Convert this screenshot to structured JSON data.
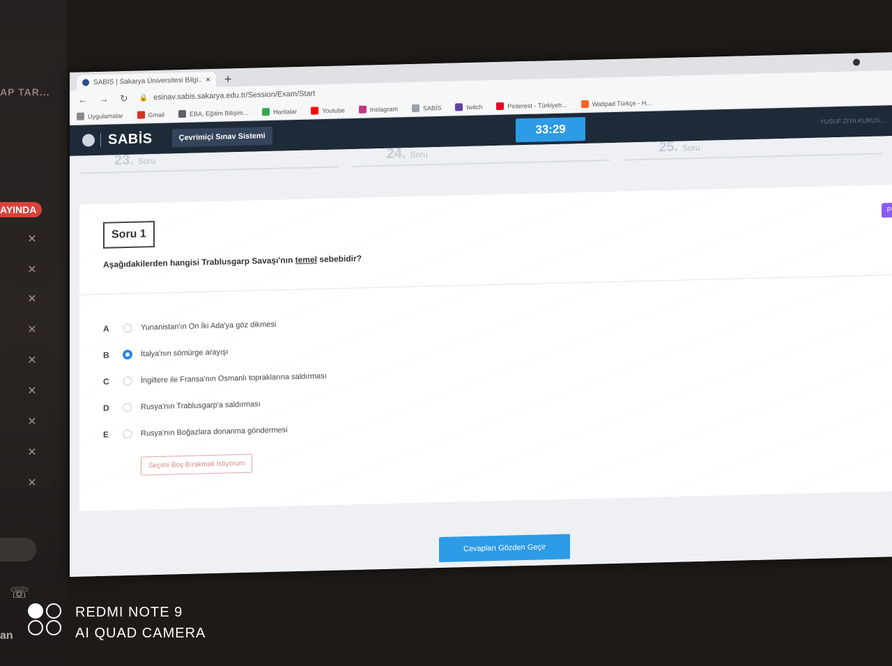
{
  "left_panel": {
    "cut_title": "AP TAR...",
    "live_badge": "AYINDA",
    "bottom_text": "an"
  },
  "browser": {
    "tab_title": "SABİS | Sakarya Üniversitesi Bilgi...",
    "url": "esinav.sabis.sakarya.edu.tr/Session/Exam/Start",
    "bookmarks": [
      {
        "label": "Uygulamalar",
        "color": "#8a8a8a"
      },
      {
        "label": "Gmail",
        "color": "#d93025"
      },
      {
        "label": "EBA, Eğitim Bilişim...",
        "color": "#5f6368"
      },
      {
        "label": "Haritalar",
        "color": "#34a853"
      },
      {
        "label": "Youtube",
        "color": "#ff0000"
      },
      {
        "label": "Instagram",
        "color": "#c13584"
      },
      {
        "label": "SABİS",
        "color": "#9aa0a6"
      },
      {
        "label": "twitch",
        "color": "#6441a5"
      },
      {
        "label": "Pinterest - Türkiyetr...",
        "color": "#e60023"
      },
      {
        "label": "Wattpad Türkçe - H...",
        "color": "#ff6122"
      }
    ]
  },
  "header": {
    "logo": "SABİS",
    "system_label": "Çevrimiçi Sınav Sistemi",
    "timer": "33:29",
    "user": "YUSUF ZİYA KURUS..."
  },
  "prev_questions": [
    {
      "num": "23.",
      "label": "Soru"
    },
    {
      "num": "24.",
      "label": "Soru"
    },
    {
      "num": "25.",
      "label": "Soru"
    }
  ],
  "question": {
    "label": "Soru 1",
    "puan": "Puan",
    "text_before": "Aşağıdakilerden hangisi Trablusgarp Savaşı'nın ",
    "text_emph": "temel",
    "text_after": " sebebidir?",
    "options": [
      {
        "letter": "A",
        "text": "Yunanistan'ın On İki Ada'ya göz dikmesi",
        "selected": false
      },
      {
        "letter": "B",
        "text": "İtalya'nın sömürge arayışı",
        "selected": true
      },
      {
        "letter": "C",
        "text": "İngiltere ile Fransa'nın Osmanlı topraklarına saldırması",
        "selected": false
      },
      {
        "letter": "D",
        "text": "Rusya'nın Trablusgarp'a saldırması",
        "selected": false
      },
      {
        "letter": "E",
        "text": "Rusya'nın Boğazlara donanma göndermesi",
        "selected": false
      }
    ],
    "clear_label": "Seçimi Boş Bırakmak İstiyorum"
  },
  "review_button": "Cevapları Gözden Geçir",
  "camera": {
    "line1": "REDMI NOTE 9",
    "line2": "AI QUAD CAMERA"
  }
}
